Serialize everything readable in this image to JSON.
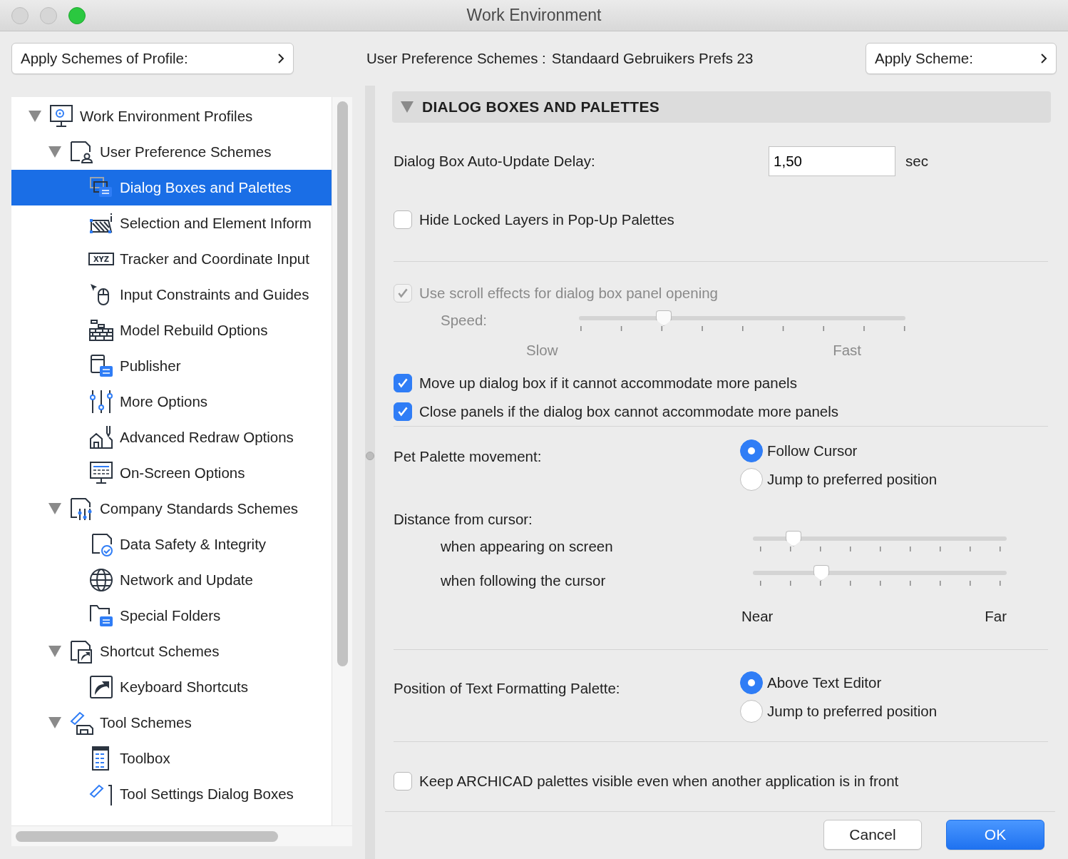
{
  "window": {
    "title": "Work Environment"
  },
  "toolbar": {
    "profile_button": "Apply Schemes of Profile:",
    "scheme_label": "User Preference Schemes :",
    "scheme_name": "Standaard Gebruikers Prefs 23",
    "apply_button": "Apply Scheme:"
  },
  "sidebar": {
    "tree": [
      {
        "label": "Work Environment Profiles",
        "expanded": true,
        "selected": false,
        "children": [
          {
            "label": "User Preference Schemes",
            "expanded": true,
            "selected": false,
            "children": [
              {
                "label": "Dialog Boxes and Palettes",
                "selected": true
              },
              {
                "label": "Selection and Element Inform",
                "selected": false
              },
              {
                "label": "Tracker and Coordinate Input",
                "icon_text": "XYZ",
                "selected": false
              },
              {
                "label": "Input Constraints and Guides",
                "selected": false
              },
              {
                "label": "Model Rebuild Options",
                "selected": false
              },
              {
                "label": "Publisher",
                "selected": false
              },
              {
                "label": "More Options",
                "selected": false
              },
              {
                "label": "Advanced Redraw Options",
                "selected": false
              },
              {
                "label": "On-Screen Options",
                "selected": false
              }
            ]
          },
          {
            "label": "Company Standards Schemes",
            "expanded": true,
            "selected": false,
            "children": [
              {
                "label": "Data Safety & Integrity",
                "selected": false
              },
              {
                "label": "Network and Update",
                "selected": false
              },
              {
                "label": "Special Folders",
                "selected": false
              }
            ]
          },
          {
            "label": "Shortcut Schemes",
            "expanded": true,
            "selected": false,
            "children": [
              {
                "label": "Keyboard Shortcuts",
                "selected": false
              }
            ]
          },
          {
            "label": "Tool Schemes",
            "expanded": true,
            "selected": false,
            "children": [
              {
                "label": "Toolbox",
                "selected": false
              },
              {
                "label": "Tool Settings Dialog Boxes",
                "selected": false
              }
            ]
          }
        ]
      }
    ]
  },
  "panel": {
    "title": "DIALOG BOXES AND PALETTES",
    "expanded": true,
    "delay": {
      "label": "Dialog Box Auto-Update Delay:",
      "value": "1,50",
      "unit": "sec"
    },
    "hide_locked": {
      "label": "Hide Locked Layers in Pop-Up Palettes",
      "checked": false
    },
    "scroll_effects": {
      "label": "Use scroll effects for dialog box panel opening",
      "checked": true,
      "disabled": true,
      "speed_label": "Speed:",
      "level": 0.26,
      "min_label": "Slow",
      "max_label": "Fast"
    },
    "panel_options": [
      {
        "label": "Move up dialog box if it cannot accommodate more panels",
        "checked": true
      },
      {
        "label": "Close panels if the dialog box cannot accommodate more panels",
        "checked": true
      }
    ],
    "pet_palette": {
      "label": "Pet Palette movement:",
      "options": [
        {
          "label": "Follow Cursor",
          "selected": true
        },
        {
          "label": "Jump to preferred position",
          "selected": false
        }
      ]
    },
    "distance": {
      "label": "Distance from cursor:",
      "sliders": [
        {
          "label": "when appearing on screen",
          "level": 0.16
        },
        {
          "label": "when following the cursor",
          "level": 0.27
        }
      ],
      "min_label": "Near",
      "max_label": "Far"
    },
    "text_palette": {
      "label": "Position of Text Formatting Palette:",
      "options": [
        {
          "label": "Above Text Editor",
          "selected": true
        },
        {
          "label": "Jump to preferred position",
          "selected": false
        }
      ]
    },
    "keep_visible": {
      "label": "Keep ARCHICAD palettes visible even when another application is in front",
      "checked": false
    }
  },
  "buttons": [
    {
      "label": "Cancel",
      "default": false
    },
    {
      "label": "OK",
      "default": true
    }
  ]
}
